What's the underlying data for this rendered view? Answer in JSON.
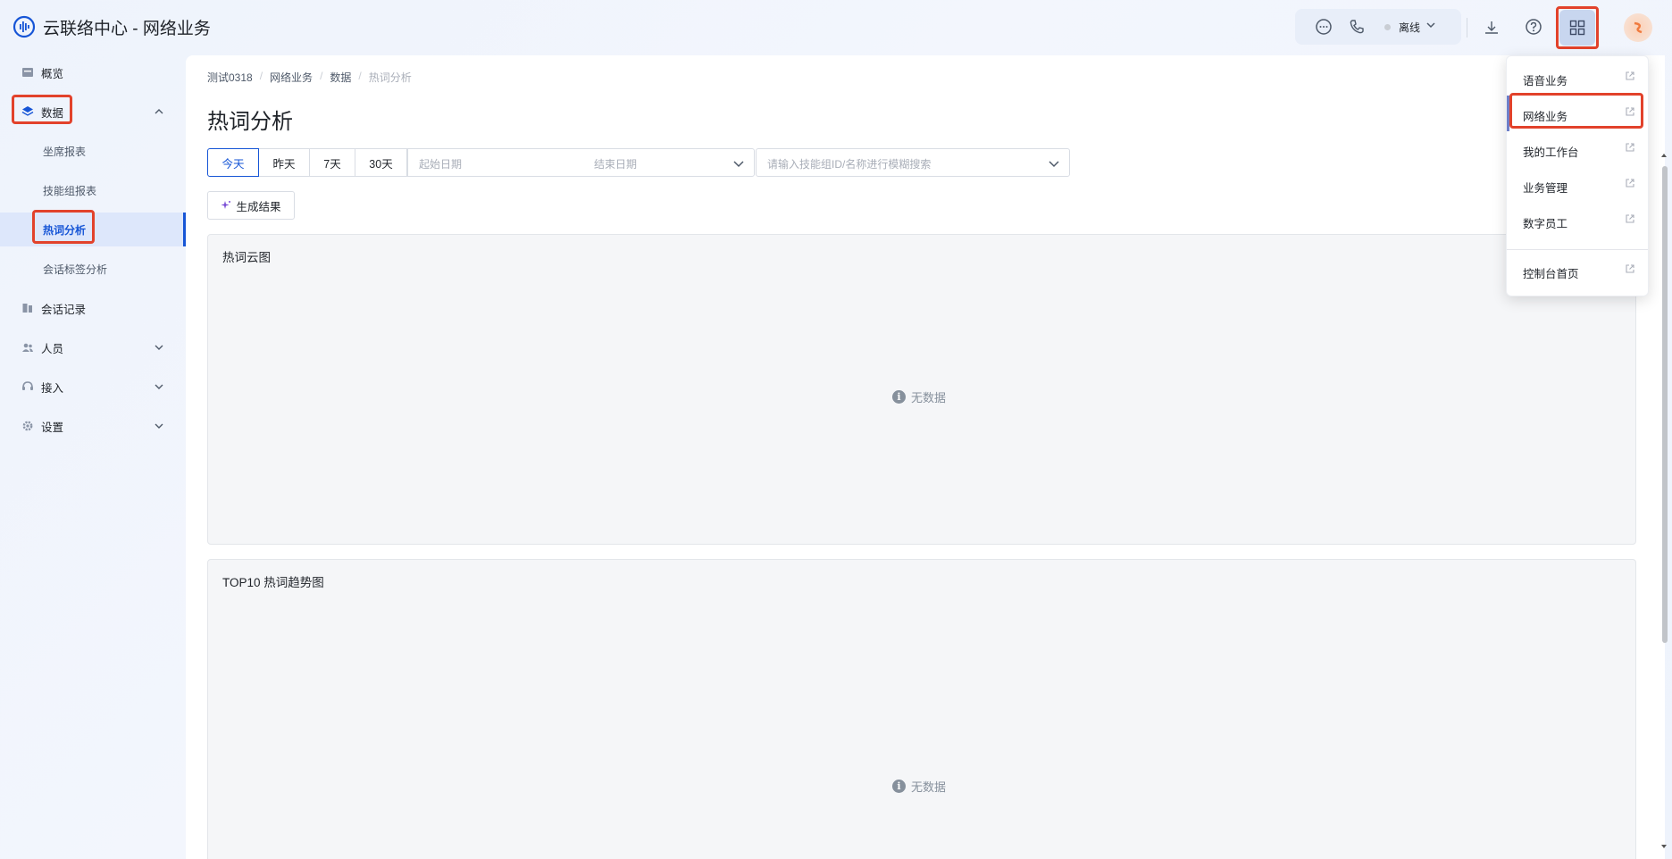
{
  "header": {
    "app_title": "云联络中心 - 网络业务",
    "status": "离线",
    "icons": [
      "chat-icon",
      "phone-icon",
      "download-icon",
      "help-icon",
      "apps-grid-icon",
      "avatar"
    ]
  },
  "sidebar": {
    "items": [
      {
        "label": "概览",
        "icon": "overview-icon"
      },
      {
        "label": "数据",
        "icon": "layers-icon",
        "expanded": true,
        "children": [
          "坐席报表",
          "技能组报表",
          "热词分析",
          "会话标签分析"
        ],
        "active_child": "热词分析"
      },
      {
        "label": "会话记录",
        "icon": "record-icon"
      },
      {
        "label": "人员",
        "icon": "people-icon"
      },
      {
        "label": "接入",
        "icon": "headset-icon"
      },
      {
        "label": "设置",
        "icon": "gear-icon"
      }
    ]
  },
  "main": {
    "breadcrumb": [
      "测试0318",
      "网络业务",
      "数据",
      "热词分析"
    ],
    "title": "热词分析",
    "date_tabs": [
      "今天",
      "昨天",
      "7天",
      "30天"
    ],
    "active_date_tab": "今天",
    "date_start_placeholder": "起始日期",
    "date_end_placeholder": "结束日期",
    "search_placeholder": "请输入技能组ID/名称进行模糊搜索",
    "generate_button": "生成结果",
    "panels": [
      {
        "title": "热词云图",
        "empty_text": "无数据"
      },
      {
        "title": "TOP10 热词趋势图",
        "empty_text": "无数据"
      }
    ]
  },
  "dropdown": {
    "items": [
      "语音业务",
      "网络业务",
      "我的工作台",
      "业务管理",
      "数字员工"
    ],
    "footer_item": "控制台首页",
    "active_item": "网络业务"
  },
  "colors": {
    "accent": "#1655d6",
    "highlight_box": "#e2422b",
    "panel_bg": "#f5f6f8"
  }
}
